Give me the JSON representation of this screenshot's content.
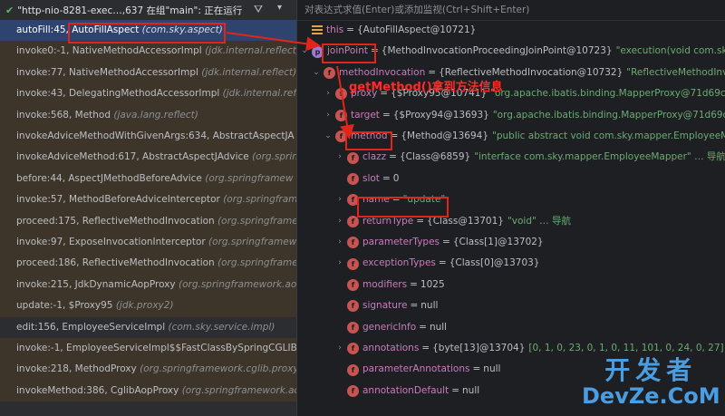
{
  "thread": {
    "label": "\"http-nio-8281-exec…,637 在组\"main\": 正在运行"
  },
  "eval_placeholder": "对表达式求值(Enter)或添加监视(Ctrl+Shift+Enter)",
  "frames": [
    {
      "loc": "autoFill:45, AutoFillAspect",
      "pkg": "(com.sky.aspect)",
      "selected": true,
      "lib": false
    },
    {
      "loc": "invoke0:-1, NativeMethodAccessorImpl",
      "pkg": "(jdk.internal.reflect)",
      "selected": false,
      "lib": true
    },
    {
      "loc": "invoke:77, NativeMethodAccessorImpl",
      "pkg": "(jdk.internal.reflect)",
      "selected": false,
      "lib": true
    },
    {
      "loc": "invoke:43, DelegatingMethodAccessorImpl",
      "pkg": "(jdk.internal.refle",
      "selected": false,
      "lib": true
    },
    {
      "loc": "invoke:568, Method",
      "pkg": "(java.lang.reflect)",
      "selected": false,
      "lib": true
    },
    {
      "loc": "invokeAdviceMethodWithGivenArgs:634, AbstractAspectJA",
      "pkg": "",
      "selected": false,
      "lib": true
    },
    {
      "loc": "invokeAdviceMethod:617, AbstractAspectJAdvice",
      "pkg": "(org.spring",
      "selected": false,
      "lib": true
    },
    {
      "loc": "before:44, AspectJMethodBeforeAdvice",
      "pkg": "(org.springframew",
      "selected": false,
      "lib": true
    },
    {
      "loc": "invoke:57, MethodBeforeAdviceInterceptor",
      "pkg": "(org.springframe",
      "selected": false,
      "lib": true
    },
    {
      "loc": "proceed:175, ReflectiveMethodInvocation",
      "pkg": "(org.springframe",
      "selected": false,
      "lib": true
    },
    {
      "loc": "invoke:97, ExposeInvocationInterceptor",
      "pkg": "(org.springframewo",
      "selected": false,
      "lib": true
    },
    {
      "loc": "proceed:186, ReflectiveMethodInvocation",
      "pkg": "(org.springframe",
      "selected": false,
      "lib": true
    },
    {
      "loc": "invoke:215, JdkDynamicAopProxy",
      "pkg": "(org.springframework.aop.",
      "selected": false,
      "lib": true
    },
    {
      "loc": "update:-1, $Proxy95",
      "pkg": "(jdk.proxy2)",
      "selected": false,
      "lib": true
    },
    {
      "loc": "edit:156, EmployeeServiceImpl",
      "pkg": "(com.sky.service.impl)",
      "selected": false,
      "lib": false
    },
    {
      "loc": "invoke:-1, EmployeeServiceImpl$$FastClassBySpringCGLIB$",
      "pkg": "",
      "selected": false,
      "lib": true
    },
    {
      "loc": "invoke:218, MethodProxy",
      "pkg": "(org.springframework.cglib.proxy)",
      "selected": false,
      "lib": true
    },
    {
      "loc": "invokeMethod:386, CglibAopProxy",
      "pkg": "(org.springframework.aop.",
      "selected": false,
      "lib": true
    }
  ],
  "variables": [
    {
      "indent": 0,
      "arrow": "",
      "icon": "list",
      "name": "this",
      "value": "{AutoFillAspect@10721}",
      "str": ""
    },
    {
      "indent": 0,
      "arrow": "v",
      "icon": "p",
      "name": "joinPoint",
      "value": "{MethodInvocationProceedingJoinPoint@10723}",
      "str": "\"execution(void com.sky.map"
    },
    {
      "indent": 1,
      "arrow": "v",
      "icon": "f",
      "name": "methodInvocation",
      "value": "{ReflectiveMethodInvocation@10732}",
      "str": "\"ReflectiveMethodInvoca"
    },
    {
      "indent": 2,
      "arrow": ">",
      "icon": "f",
      "name": "proxy",
      "value": "{$Proxy95@10741}",
      "str": "\"org.apache.ibatis.binding.MapperProxy@71d69cfd\""
    },
    {
      "indent": 2,
      "arrow": ">",
      "icon": "f",
      "name": "target",
      "value": "{$Proxy94@13693}",
      "str": "\"org.apache.ibatis.binding.MapperProxy@71d69cfd\""
    },
    {
      "indent": 2,
      "arrow": "v",
      "icon": "f",
      "name": "method",
      "value": "{Method@13694}",
      "str": "\"public abstract void com.sky.mapper.EmployeeMapper.u"
    },
    {
      "indent": 3,
      "arrow": ">",
      "icon": "f",
      "name": "clazz",
      "value": "{Class@6859}",
      "str": "\"interface com.sky.mapper.EmployeeMapper\" … 导航"
    },
    {
      "indent": 3,
      "arrow": "",
      "icon": "f",
      "name": "slot",
      "value": "0",
      "str": ""
    },
    {
      "indent": 3,
      "arrow": ">",
      "icon": "f",
      "name": "name",
      "value": "",
      "str": "\"update\""
    },
    {
      "indent": 3,
      "arrow": ">",
      "icon": "f",
      "name": "returnType",
      "value": "{Class@13701}",
      "str": "\"void\" … 导航"
    },
    {
      "indent": 3,
      "arrow": ">",
      "icon": "f",
      "name": "parameterTypes",
      "value": "{Class[1]@13702}",
      "str": ""
    },
    {
      "indent": 3,
      "arrow": ">",
      "icon": "f",
      "name": "exceptionTypes",
      "value": "{Class[0]@13703}",
      "str": ""
    },
    {
      "indent": 3,
      "arrow": "",
      "icon": "f",
      "name": "modifiers",
      "value": "1025",
      "str": ""
    },
    {
      "indent": 3,
      "arrow": "",
      "icon": "f",
      "name": "signature",
      "value": "null",
      "str": ""
    },
    {
      "indent": 3,
      "arrow": "",
      "icon": "f",
      "name": "genericInfo",
      "value": "null",
      "str": ""
    },
    {
      "indent": 3,
      "arrow": ">",
      "icon": "f",
      "name": "annotations",
      "value": "{byte[13]@13704}",
      "str": "[0, 1, 0, 23, 0, 1, 0, 11, 101, 0, 24, 0, 27]"
    },
    {
      "indent": 3,
      "arrow": "",
      "icon": "f",
      "name": "parameterAnnotations",
      "value": "null",
      "str": ""
    },
    {
      "indent": 3,
      "arrow": "",
      "icon": "f",
      "name": "annotationDefault",
      "value": "null",
      "str": ""
    }
  ],
  "annotation_text": "getMethod()拿到方法信息",
  "watermark": {
    "cn": "开发者",
    "en": "DevZe.CoM"
  },
  "colors": {
    "highlight": "#e0261b",
    "selected_frame": "#2e436e",
    "library_frame": "#3d3529",
    "watermark": "#4a9de0"
  }
}
